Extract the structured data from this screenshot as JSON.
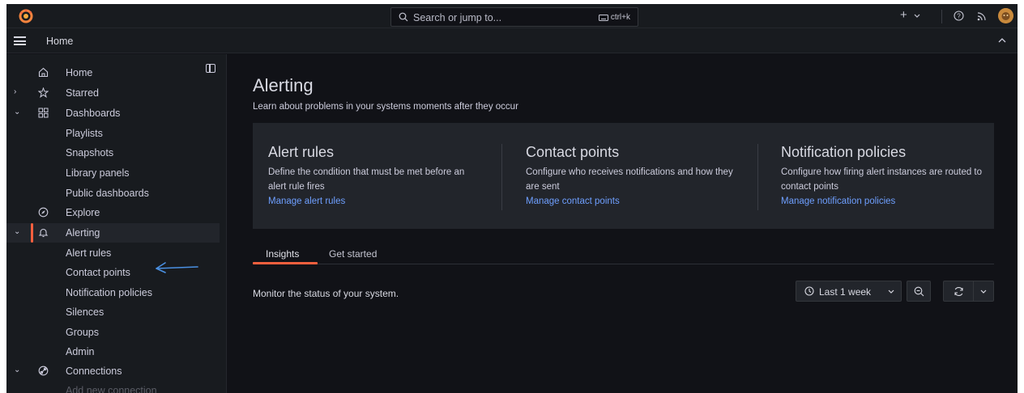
{
  "topbar": {
    "search_placeholder": "Search or jump to...",
    "shortcut": "ctrl+k",
    "add_label": "+",
    "icons": [
      "grafana-logo",
      "search-icon",
      "keyboard-icon",
      "plus-icon",
      "chevron-down-icon",
      "help-icon",
      "news-icon",
      "avatar"
    ]
  },
  "breadcrumb": {
    "label": "Home"
  },
  "sidebar": {
    "items": [
      {
        "label": "Home",
        "icon": "home-icon",
        "chevron": ""
      },
      {
        "label": "Starred",
        "icon": "star-icon",
        "chevron": "›"
      },
      {
        "label": "Dashboards",
        "icon": "apps-icon",
        "chevron": "⌄"
      },
      {
        "label": "Playlists"
      },
      {
        "label": "Snapshots"
      },
      {
        "label": "Library panels"
      },
      {
        "label": "Public dashboards"
      },
      {
        "label": "Explore",
        "icon": "compass-icon"
      },
      {
        "label": "Alerting",
        "icon": "bell-icon",
        "chevron": "⌄",
        "active": true
      },
      {
        "label": "Alert rules"
      },
      {
        "label": "Contact points"
      },
      {
        "label": "Notification policies"
      },
      {
        "label": "Silences"
      },
      {
        "label": "Groups"
      },
      {
        "label": "Admin"
      },
      {
        "label": "Connections",
        "icon": "link-icon",
        "chevron": "⌄"
      },
      {
        "label": "Add new connection"
      }
    ]
  },
  "main": {
    "title": "Alerting",
    "subtitle": "Learn about problems in your systems moments after they occur",
    "cards": [
      {
        "title": "Alert rules",
        "desc": "Define the condition that must be met before an alert rule fires",
        "link": "Manage alert rules"
      },
      {
        "title": "Contact points",
        "desc": "Configure who receives notifications and how they are sent",
        "link": "Manage contact points"
      },
      {
        "title": "Notification policies",
        "desc": "Configure how firing alert instances are routed to contact points",
        "link": "Manage notification policies"
      }
    ],
    "tabs": [
      {
        "label": "Insights",
        "active": true
      },
      {
        "label": "Get started",
        "active": false
      }
    ],
    "monitor_text": "Monitor the status of your system.",
    "time_range": "Last 1 week"
  },
  "colors": {
    "accent": "#f55f3e",
    "link": "#6e9fff",
    "background": "#111217",
    "panel": "#181b1f",
    "card": "#22252b"
  }
}
